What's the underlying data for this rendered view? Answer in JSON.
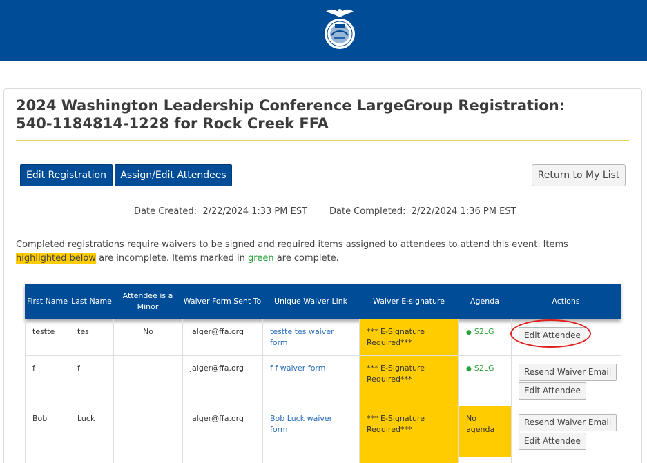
{
  "header": {
    "logo": "ffa-emblem-icon",
    "brand_color": "#004c97"
  },
  "page": {
    "title_line1": "2024 Washington Leadership Conference LargeGroup Registration:",
    "title_line2": "540-1184814-1228 for Rock Creek FFA"
  },
  "toolbar": {
    "edit_registration": "Edit Registration",
    "assign_attendees": "Assign/Edit Attendees",
    "return_to_list": "Return to My List"
  },
  "dates": {
    "created_label": "Date Created:",
    "created_value": "2/22/2024 1:33 PM EST",
    "completed_label": "Date Completed:",
    "completed_value": "2/22/2024 1:36 PM EST"
  },
  "notice": {
    "part1": "Completed registrations require waivers to be signed and required items assigned to attendees to attend this event. Items",
    "highlight": "highlighted below",
    "part2": "are incomplete. Items marked in",
    "green": "green",
    "part3": "are complete.",
    "highlight_color": "#ffcc00",
    "complete_color": "#2aa13a"
  },
  "table": {
    "headers": [
      "First Name",
      "Last Name",
      "Attendee is a Minor",
      "Waiver Form Sent To",
      "Unique Waiver Link",
      "Waiver E-signature",
      "Agenda",
      "Actions"
    ],
    "rows": [
      {
        "first": "testte",
        "last": "tes",
        "minor": "No",
        "sent_to": "jalger@ffa.org",
        "waiver_link": "testte tes waiver form",
        "esignature": "*** E-Signature Required***",
        "agenda": "S2LG",
        "actions": [
          "Edit Attendee"
        ]
      },
      {
        "first": "f",
        "last": "f",
        "minor": "",
        "sent_to": "jalger@ffa.org",
        "waiver_link": "f f waiver form",
        "esignature": "*** E-Signature Required***",
        "agenda": "S2LG",
        "actions": [
          "Resend Waiver Email",
          "Edit Attendee"
        ]
      },
      {
        "first": "Bob",
        "last": "Luck",
        "minor": "",
        "sent_to": "jalger@ffa.org",
        "waiver_link": "Bob Luck waiver form",
        "esignature": "*** E-Signature Required***",
        "agenda": "No agenda",
        "actions": [
          "Resend Waiver Email",
          "Edit Attendee"
        ]
      }
    ]
  }
}
